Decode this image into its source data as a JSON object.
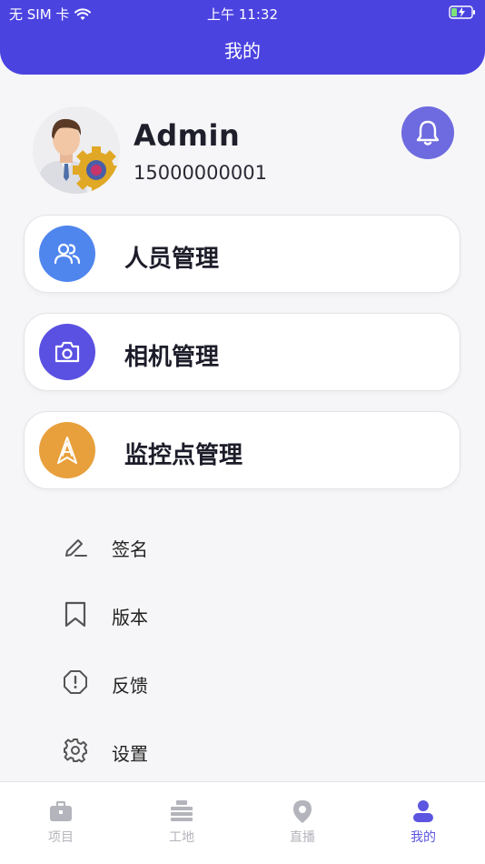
{
  "status_bar": {
    "carrier": "无 SIM 卡",
    "time": "上午 11:32"
  },
  "header": {
    "title": "我的"
  },
  "profile": {
    "name": "Admin",
    "phone": "15000000001"
  },
  "cards": [
    {
      "label": "人员管理",
      "icon": "users-icon",
      "color": "#4f86ee"
    },
    {
      "label": "相机管理",
      "icon": "camera-icon",
      "color": "#5a50e2"
    },
    {
      "label": "监控点管理",
      "icon": "monitor-point-icon",
      "color": "#e8a03c"
    }
  ],
  "menu": [
    {
      "label": "签名",
      "icon": "pen-icon"
    },
    {
      "label": "版本",
      "icon": "bookmark-icon"
    },
    {
      "label": "反馈",
      "icon": "alert-octagon-icon"
    },
    {
      "label": "设置",
      "icon": "gear-icon"
    }
  ],
  "tabs": [
    {
      "label": "项目",
      "icon": "briefcase-icon",
      "active": false
    },
    {
      "label": "工地",
      "icon": "site-icon",
      "active": false
    },
    {
      "label": "直播",
      "icon": "location-pin-icon",
      "active": false
    },
    {
      "label": "我的",
      "icon": "person-icon",
      "active": true
    }
  ],
  "colors": {
    "primary": "#4b43e0",
    "accent_bell": "#6e6adf",
    "tab_active": "#5b55e0",
    "tab_inactive": "#b4b4bc"
  }
}
